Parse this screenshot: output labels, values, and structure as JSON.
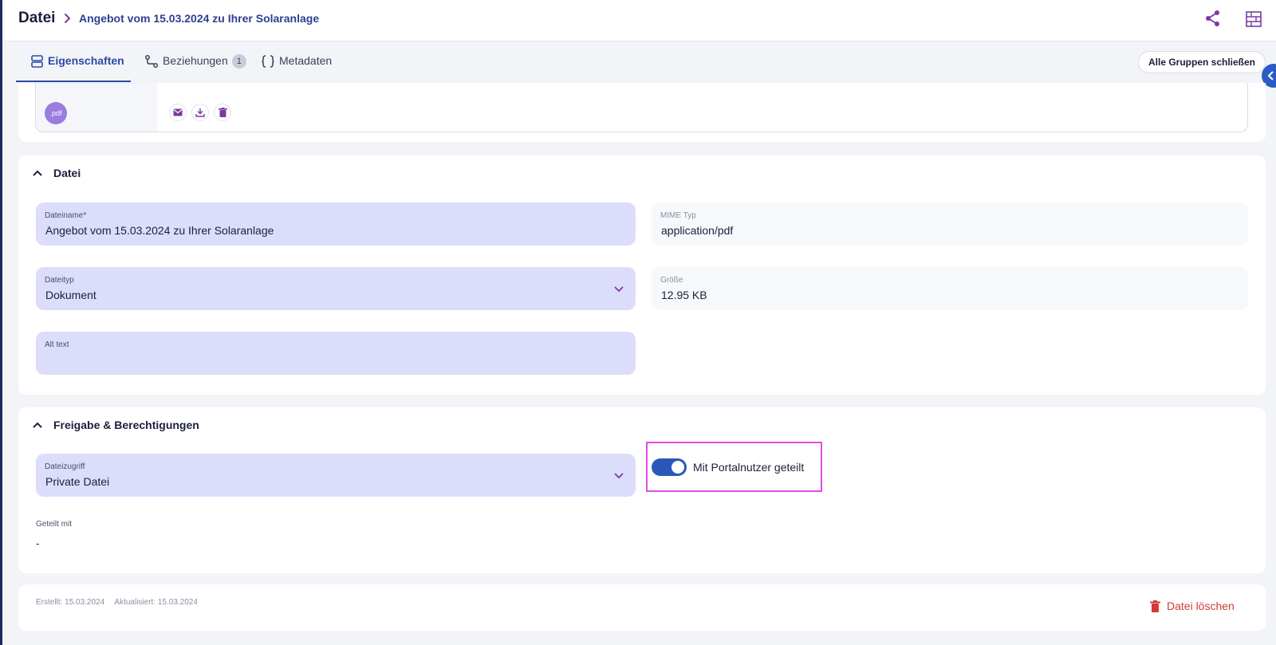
{
  "header": {
    "title": "Datei",
    "breadcrumb": "Angebot vom 15.03.2024 zu Ihrer Solaranlage"
  },
  "tabs": [
    {
      "label": "Eigenschaften",
      "icon": "list-icon",
      "active": true
    },
    {
      "label": "Beziehungen",
      "icon": "relations-icon",
      "badge": "1"
    },
    {
      "label": "Metadaten",
      "icon": "braces-icon"
    }
  ],
  "toolbar": {
    "collapse_all": "Alle Gruppen schließen"
  },
  "file_preview": {
    "extension": ".pdf"
  },
  "section_file": {
    "title": "Datei",
    "filename": {
      "label": "Dateiname*",
      "value": "Angebot vom 15.03.2024 zu Ihrer Solaranlage"
    },
    "mime": {
      "label": "MIME Typ",
      "value": "application/pdf"
    },
    "filetype": {
      "label": "Dateityp",
      "value": "Dokument"
    },
    "size": {
      "label": "Größe",
      "value": "12.95 KB"
    },
    "alt_text": {
      "label": "Alt text",
      "value": ""
    }
  },
  "section_sharing": {
    "title": "Freigabe & Berechtigungen",
    "access": {
      "label": "Dateizugriff",
      "value": "Private Datei"
    },
    "portal_toggle": {
      "label": "Mit Portalnutzer geteilt",
      "on": true
    },
    "shared_with": {
      "label": "Geteilt mit",
      "value": "-"
    }
  },
  "footer": {
    "created": "Erstellt: 15.03.2024",
    "updated": "Aktualisiert: 15.03.2024",
    "delete_label": "Datei löschen"
  },
  "colors": {
    "accent": "#2b4aa6",
    "field_bg": "#dcdcfb",
    "danger": "#d23a3a",
    "highlight": "#e24ce6"
  }
}
